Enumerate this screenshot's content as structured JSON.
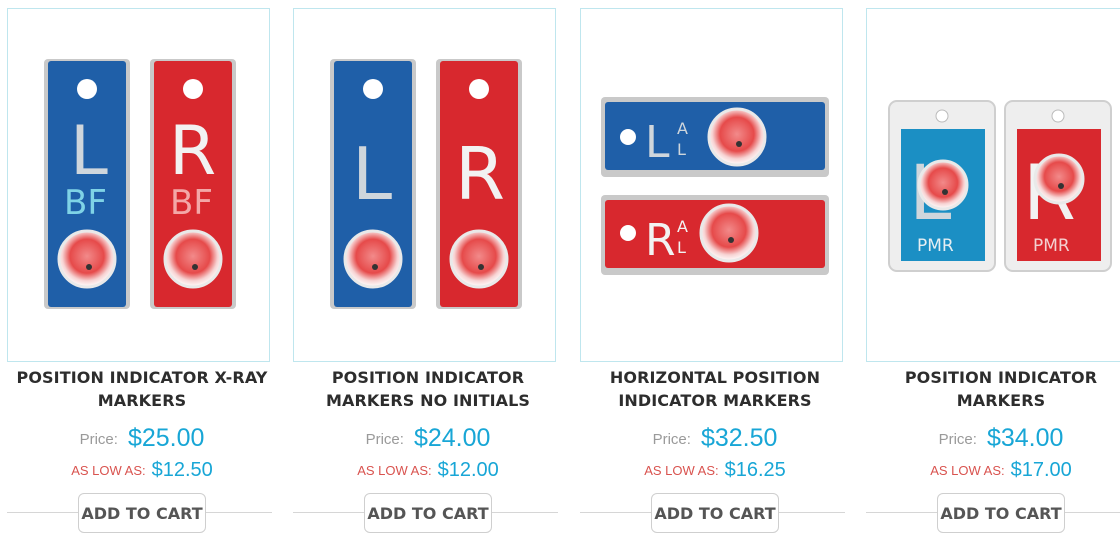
{
  "colors": {
    "marker_blue": "#1f5fa8",
    "marker_red": "#d8282e",
    "price": "#18a6d6",
    "low_label": "#d9534f"
  },
  "products": [
    {
      "title_line1": "POSITION INDICATOR X-RAY",
      "title_line2": "MARKERS",
      "price_label": "Price:",
      "price": "$25.00",
      "low_label": "AS LOW AS:",
      "low_price": "$12.50",
      "button": "ADD TO CART",
      "image_text": {
        "left": "L",
        "right": "R",
        "sub": "BF"
      }
    },
    {
      "title_line1": "POSITION INDICATOR",
      "title_line2": "MARKERS NO INITIALS",
      "price_label": "Price:",
      "price": "$24.00",
      "low_label": "AS LOW AS:",
      "low_price": "$12.00",
      "button": "ADD TO CART",
      "image_text": {
        "left": "L",
        "right": "R"
      }
    },
    {
      "title_line1": "HORIZONTAL POSITION",
      "title_line2": "INDICATOR MARKERS",
      "price_label": "Price:",
      "price": "$32.50",
      "low_label": "AS LOW AS:",
      "low_price": "$16.25",
      "button": "ADD TO CART",
      "image_text": {
        "left": "L",
        "right": "R",
        "top_small": "A",
        "bot_small": "L"
      }
    },
    {
      "title_line1": "POSITION INDICATOR",
      "title_line2": "MARKERS",
      "price_label": "Price:",
      "price": "$34.00",
      "low_label": "AS LOW AS:",
      "low_price": "$17.00",
      "button": "ADD TO CART",
      "image_text": {
        "left": "L",
        "right": "R",
        "sub": "PMR"
      }
    }
  ]
}
